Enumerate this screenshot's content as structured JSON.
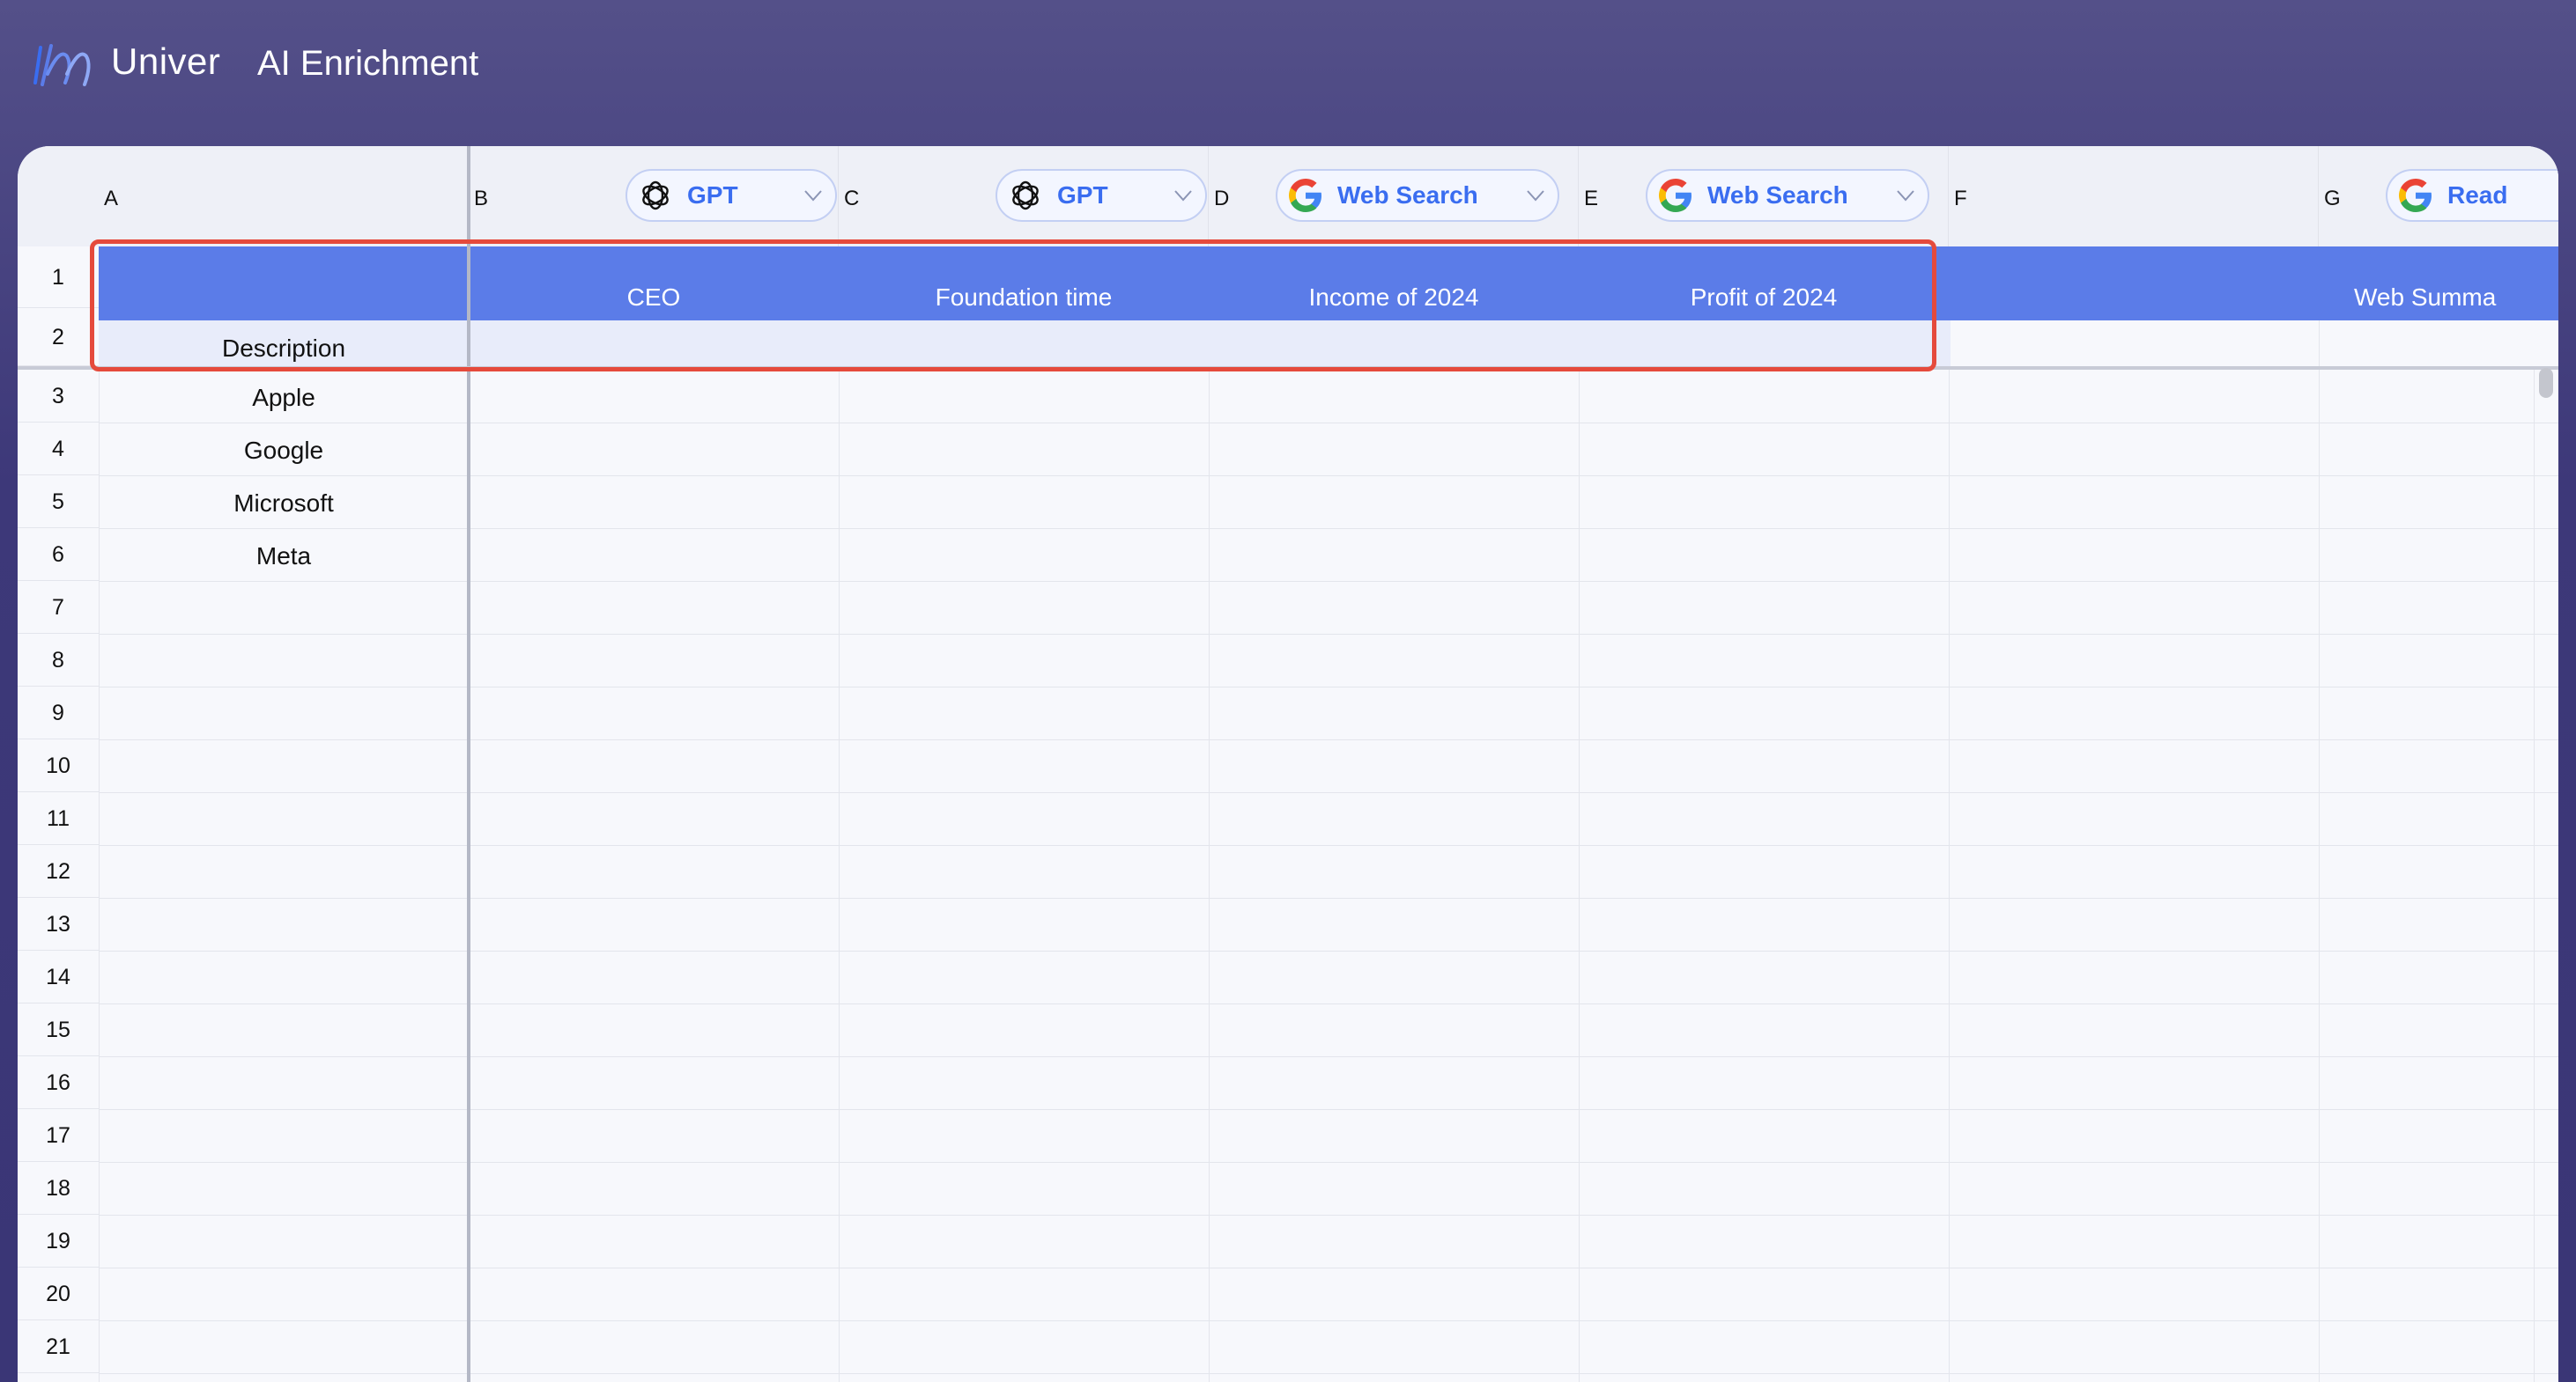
{
  "app": {
    "brand": "Univer",
    "title": "AI Enrichment"
  },
  "columns": [
    {
      "letter": "A"
    },
    {
      "letter": "B",
      "tool": "GPT",
      "tool_icon": "openai-icon"
    },
    {
      "letter": "C",
      "tool": "GPT",
      "tool_icon": "openai-icon"
    },
    {
      "letter": "D",
      "tool": "Web Search",
      "tool_icon": "google-icon"
    },
    {
      "letter": "E",
      "tool": "Web Search",
      "tool_icon": "google-icon"
    },
    {
      "letter": "F"
    },
    {
      "letter": "G",
      "tool": "Read",
      "tool_icon": "google-icon"
    }
  ],
  "header_row": {
    "B": "CEO",
    "C": "Foundation time",
    "D": "Income of 2024",
    "E": "Profit of 2024",
    "G": "Web Summa"
  },
  "rows": {
    "numbers": [
      "1",
      "2",
      "3",
      "4",
      "5",
      "6",
      "7",
      "8",
      "9",
      "10",
      "11",
      "12",
      "13",
      "14",
      "15",
      "16",
      "17",
      "18",
      "19",
      "20",
      "21"
    ],
    "A": {
      "2": "Description",
      "3": "Apple",
      "4": "Google",
      "5": "Microsoft",
      "6": "Meta"
    }
  },
  "colors": {
    "accent": "#3a6df0",
    "header_band": "#5b7ce8",
    "selection": "#e54a3c",
    "topbar": "#545089"
  }
}
